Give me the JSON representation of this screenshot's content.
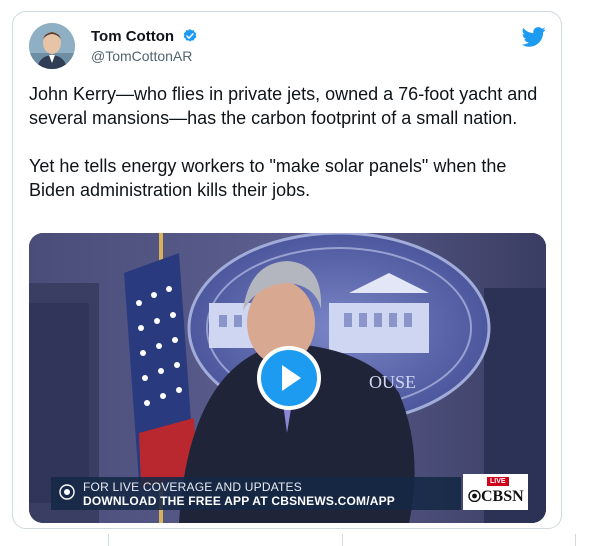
{
  "tweet": {
    "author_name": "Tom Cotton",
    "handle": "@TomCottonAR",
    "verified_icon": "verified-badge-icon",
    "platform_icon": "twitter-bird-icon",
    "paragraphs": [
      "John Kerry—who flies in private jets, owned a 76-foot yacht and several mansions—has the carbon footprint of a small nation.",
      "Yet he tells energy workers to \"make solar panels\" when the Biden administration kills their jobs."
    ]
  },
  "video": {
    "podium_seal_text": "OUSE",
    "lower_third": {
      "line1": "FOR LIVE COVERAGE AND UPDATES",
      "line2": "DOWNLOAD THE FREE APP AT CBSNEWS.COM/APP"
    },
    "network_badge": {
      "live": "LIVE",
      "label": "CBSN"
    },
    "play_icon": "play-icon"
  },
  "colors": {
    "accent": "#1d9bf0",
    "text": "#0f1419",
    "secondary_text": "#536471",
    "border": "#cfd9de"
  }
}
